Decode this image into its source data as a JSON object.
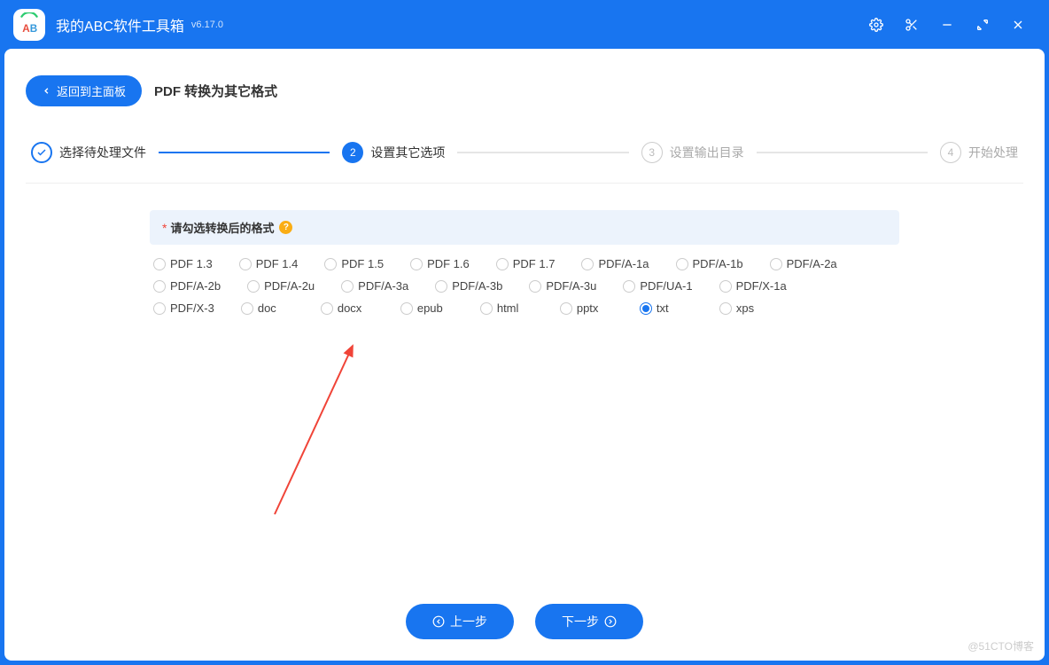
{
  "titlebar": {
    "app_name": "我的ABC软件工具箱",
    "version": "v6.17.0"
  },
  "header": {
    "back_label": "返回到主面板",
    "page_title": "PDF 转换为其它格式"
  },
  "stepper": {
    "steps": [
      {
        "num": "",
        "label": "选择待处理文件",
        "state": "done"
      },
      {
        "num": "2",
        "label": "设置其它选项",
        "state": "current"
      },
      {
        "num": "3",
        "label": "设置输出目录",
        "state": "todo"
      },
      {
        "num": "4",
        "label": "开始处理",
        "state": "todo"
      }
    ]
  },
  "content": {
    "section_title": "请勾选转换后的格式",
    "help_icon": "?",
    "required_mark": "*",
    "selected_value": "txt",
    "format_options": [
      "PDF 1.3",
      "PDF 1.4",
      "PDF 1.5",
      "PDF 1.6",
      "PDF 1.7",
      "PDF/A-1a",
      "PDF/A-1b",
      "PDF/A-2a",
      "PDF/A-2b",
      "PDF/A-2u",
      "PDF/A-3a",
      "PDF/A-3b",
      "PDF/A-3u",
      "PDF/UA-1",
      "PDF/X-1a",
      "PDF/X-3",
      "doc",
      "docx",
      "epub",
      "html",
      "pptx",
      "txt",
      "xps"
    ]
  },
  "footer": {
    "prev_label": "上一步",
    "next_label": "下一步"
  },
  "watermark": "@51CTO博客"
}
